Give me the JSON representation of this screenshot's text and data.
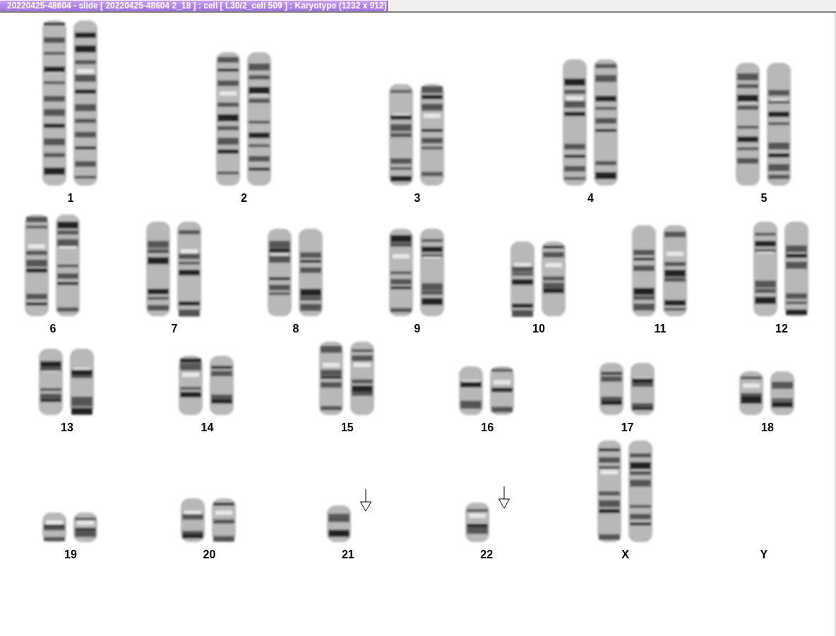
{
  "window": {
    "title": "20220425-48604 - slide [ 20220425-48604 2_18 ] : cell [ L30/2_cell 509 ] : Karyotype  (1232 x 912)"
  },
  "karyotype_rows": [
    {
      "groups": [
        {
          "label": "1",
          "kind": "pair",
          "marked": false
        },
        {
          "label": "2",
          "kind": "pair",
          "marked": false
        },
        {
          "label": "3",
          "kind": "pair",
          "marked": false
        },
        {
          "label": "4",
          "kind": "pair",
          "marked": false
        },
        {
          "label": "5",
          "kind": "pair",
          "marked": false
        }
      ]
    },
    {
      "groups": [
        {
          "label": "6",
          "kind": "pair",
          "marked": false
        },
        {
          "label": "7",
          "kind": "pair",
          "marked": false
        },
        {
          "label": "8",
          "kind": "pair",
          "marked": false
        },
        {
          "label": "9",
          "kind": "pair",
          "marked": false
        },
        {
          "label": "10",
          "kind": "pair",
          "marked": false
        },
        {
          "label": "11",
          "kind": "pair",
          "marked": false
        },
        {
          "label": "12",
          "kind": "pair",
          "marked": false
        }
      ]
    },
    {
      "groups": [
        {
          "label": "13",
          "kind": "pair",
          "marked": false
        },
        {
          "label": "14",
          "kind": "pair",
          "marked": false
        },
        {
          "label": "15",
          "kind": "pair",
          "marked": false
        },
        {
          "label": "16",
          "kind": "pair",
          "marked": false
        },
        {
          "label": "17",
          "kind": "pair",
          "marked": false
        },
        {
          "label": "18",
          "kind": "pair",
          "marked": false
        }
      ]
    },
    {
      "groups": [
        {
          "label": "19",
          "kind": "pair",
          "marked": false
        },
        {
          "label": "20",
          "kind": "pair",
          "marked": false
        },
        {
          "label": "21",
          "kind": "single",
          "marked": true
        },
        {
          "label": "22",
          "kind": "single",
          "marked": true
        },
        {
          "label": "X",
          "kind": "pair",
          "marked": false
        },
        {
          "label": "Y",
          "kind": "none",
          "marked": false
        }
      ]
    }
  ]
}
